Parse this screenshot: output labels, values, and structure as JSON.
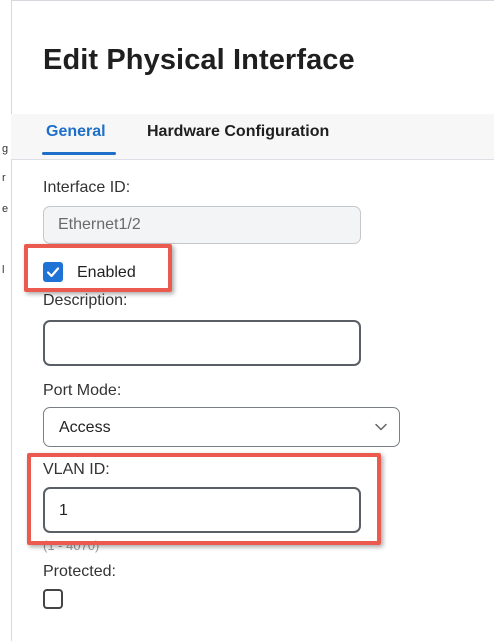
{
  "left_fragments": [
    "g",
    "r",
    "e",
    "l"
  ],
  "dialog": {
    "title": "Edit Physical Interface"
  },
  "tabs": [
    {
      "label": "General",
      "active": true
    },
    {
      "label": "Hardware Configuration",
      "active": false
    }
  ],
  "form": {
    "interface_id": {
      "label": "Interface ID:",
      "value": "Ethernet1/2"
    },
    "enabled": {
      "label": "Enabled",
      "checked": true
    },
    "description": {
      "label": "Description:",
      "value": ""
    },
    "port_mode": {
      "label": "Port Mode:",
      "value": "Access"
    },
    "vlan_id": {
      "label": "VLAN ID:",
      "value": "1",
      "hint": "(1 - 4070)"
    },
    "protected": {
      "label": "Protected:",
      "checked": false
    }
  },
  "colors": {
    "accent": "#1e6fc8",
    "checkbox": "#1f73d6",
    "annotation": "#ea5a4f"
  }
}
